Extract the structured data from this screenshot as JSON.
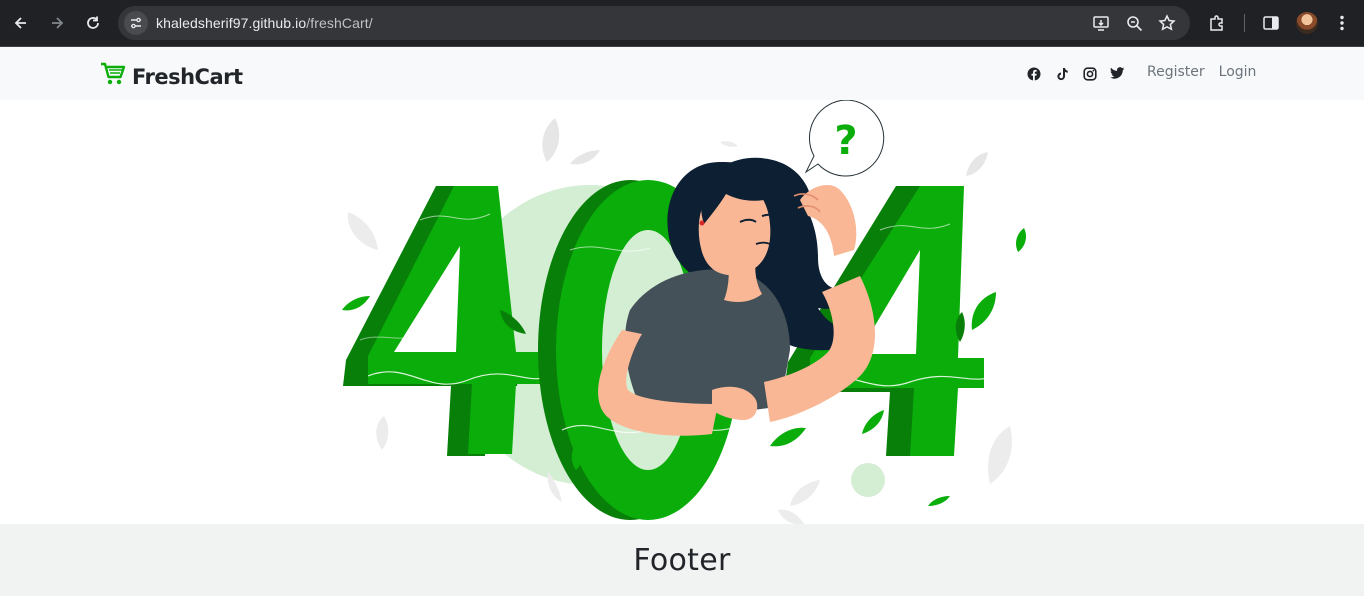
{
  "browser": {
    "url_host": "khaledsherif97.github.io",
    "url_path": "/freshCart/",
    "icons": [
      "back-icon",
      "forward-icon",
      "reload-icon",
      "site-settings-icon",
      "install-icon",
      "zoom-icon",
      "bookmark-star-icon",
      "extensions-icon",
      "side-panel-icon",
      "avatar",
      "menu-icon"
    ]
  },
  "navbar": {
    "brand": "FreshCart",
    "social_icons": [
      "facebook-icon",
      "tiktok-icon",
      "instagram-icon",
      "twitter-icon"
    ],
    "links": {
      "register": "Register",
      "login": "Login"
    }
  },
  "illustration": {
    "digits": "404",
    "question": "?",
    "colors": {
      "primary": "#0aad0a",
      "dark": "#087f08",
      "light": "#d4eed4"
    }
  },
  "footer": {
    "title": "Footer"
  }
}
